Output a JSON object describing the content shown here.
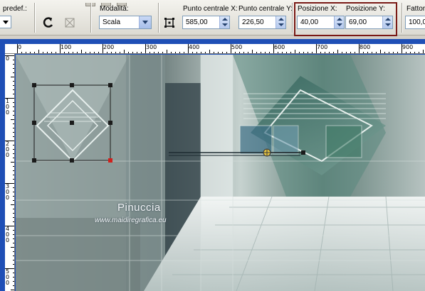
{
  "toolbar": {
    "preset_label": "predef.:",
    "mode_label": "Modalità:",
    "mode_value": "Scala",
    "center_x_label": "Punto centrale X:",
    "center_x_value": "585,00",
    "center_y_label": "Punto centrale Y:",
    "center_y_value": "226,50",
    "pos_x_label": "Posizione X:",
    "pos_x_value": "40,00",
    "pos_y_label": "Posizione Y:",
    "pos_y_value": "69,00",
    "factor_label": "Fattor",
    "factor_value": "100,0"
  },
  "ruler": {
    "top_labels": [
      "0",
      "100",
      "200",
      "300",
      "400",
      "500",
      "600",
      "700",
      "800",
      "900"
    ],
    "left_labels": [
      "0",
      "100",
      "200",
      "300",
      "400",
      "500"
    ]
  },
  "watermark": {
    "name": "Pinuccia",
    "url": "www.maidiregrafica.eu"
  },
  "colors": {
    "accent_highlight": "#7a1a16",
    "canvas_border": "#1f4fb6",
    "handle_anchor": "#d0201c"
  },
  "icons": [
    "reset-icon",
    "transform-icon",
    "center-icon",
    "dropdown-icon",
    "spinner-icon"
  ]
}
